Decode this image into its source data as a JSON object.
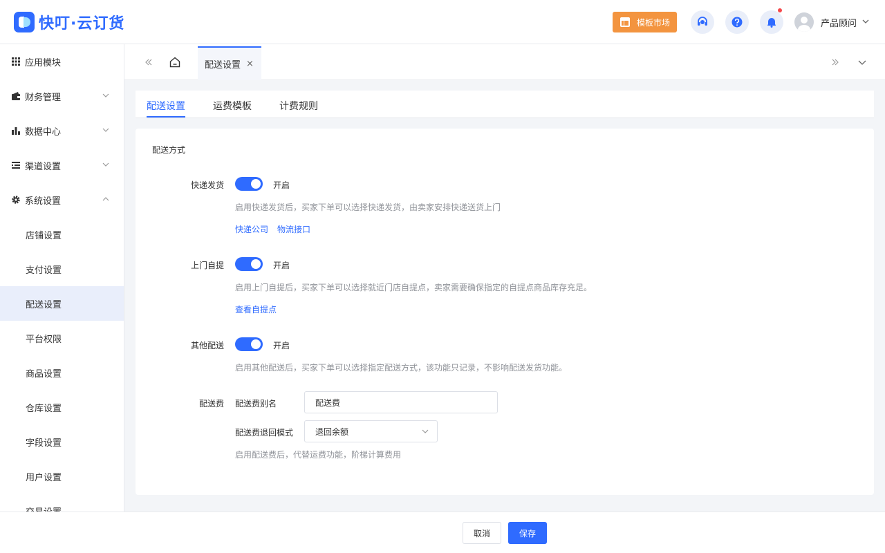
{
  "app": {
    "brand": "快叮·云订货"
  },
  "header": {
    "market_label": "模板市场",
    "user_name": "产品顾问"
  },
  "sidebar": {
    "items": [
      {
        "label": "应用模块",
        "icon": "grid-icon"
      },
      {
        "label": "财务管理",
        "icon": "wallet-icon"
      },
      {
        "label": "数据中心",
        "icon": "bar-chart-icon"
      },
      {
        "label": "渠道设置",
        "icon": "list-icon"
      },
      {
        "label": "系统设置",
        "icon": "gear-icon"
      }
    ],
    "sub_items": [
      "店铺设置",
      "支付设置",
      "配送设置",
      "平台权限",
      "商品设置",
      "仓库设置",
      "字段设置",
      "用户设置",
      "交易设置"
    ]
  },
  "tabbar": {
    "open_tab": "配送设置",
    "close_glyph": "×"
  },
  "subtabs": [
    "配送设置",
    "运费模板",
    "计费规则"
  ],
  "panel": {
    "section_title": "配送方式",
    "express": {
      "label": "快递发货",
      "switch_text": "开启",
      "hint": "启用快递发货后，买家下单可以选择快递发货，由卖家安排快递送货上门",
      "links": [
        "快递公司",
        "物流接口"
      ]
    },
    "pickup": {
      "label": "上门自提",
      "switch_text": "开启",
      "hint": "启用上门自提后，买家下单可以选择就近门店自提点，卖家需要确保指定的自提点商品库存充足。",
      "link": "查看自提点"
    },
    "other": {
      "label": "其他配送",
      "switch_text": "开启",
      "hint": "启用其他配送后，买家下单可以选择指定配送方式，该功能只记录，不影响配送发货功能。"
    },
    "fee": {
      "label": "配送费",
      "alias_label": "配送费别名",
      "alias_value": "配送费",
      "return_label": "配送费退回模式",
      "return_value": "退回余额",
      "hint": "启用配送费后，代替运费功能，阶梯计算费用"
    }
  },
  "footer": {
    "cancel": "取消",
    "save": "保存"
  },
  "colors": {
    "primary": "#2f6bff",
    "market": "#f3943f",
    "notify_dot": "#f5484b"
  }
}
